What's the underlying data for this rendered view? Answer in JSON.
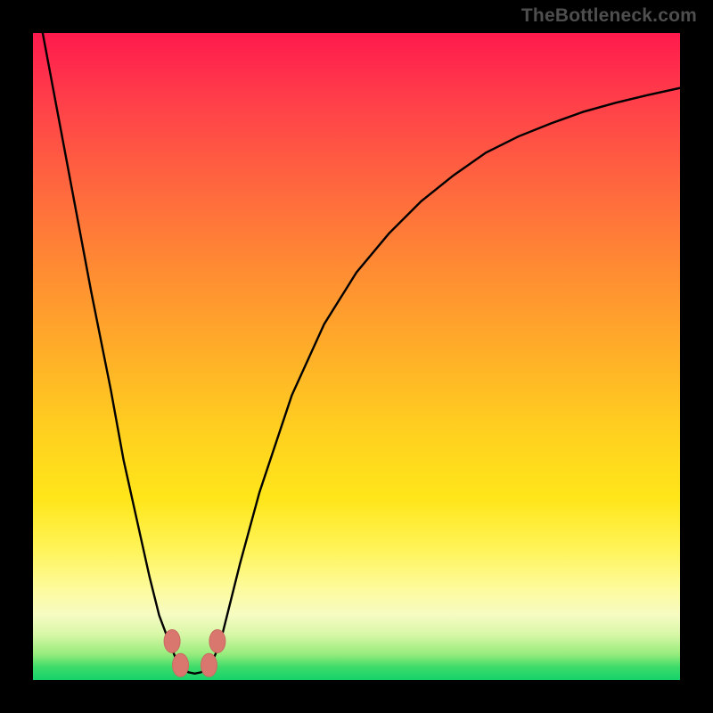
{
  "watermark": "TheBottleneck.com",
  "colors": {
    "curve": "#000000",
    "marker_fill": "#d9776e",
    "marker_stroke": "#c96a62"
  },
  "chart_data": {
    "type": "line",
    "title": "",
    "xlabel": "",
    "ylabel": "",
    "xlim": [
      0,
      100
    ],
    "ylim": [
      0,
      100
    ],
    "note": "axes unlabeled; values are reconstructed relative positions",
    "x": [
      0,
      3,
      6,
      9,
      12,
      14,
      16,
      18,
      19.5,
      21,
      22,
      23,
      24,
      25,
      26,
      27,
      28,
      29,
      30,
      32,
      35,
      40,
      45,
      50,
      55,
      60,
      65,
      70,
      75,
      80,
      85,
      90,
      95,
      100
    ],
    "y": [
      108,
      92,
      76,
      60,
      45,
      34,
      25,
      16,
      10,
      6,
      3.5,
      2,
      1.2,
      1,
      1.2,
      2,
      3.5,
      6,
      10,
      18,
      29,
      44,
      55,
      63,
      69,
      74,
      78,
      81.5,
      84,
      86,
      87.8,
      89.2,
      90.4,
      91.5
    ],
    "markers": [
      {
        "x": 21.5,
        "y": 6.0
      },
      {
        "x": 22.8,
        "y": 2.3
      },
      {
        "x": 27.2,
        "y": 2.3
      },
      {
        "x": 28.5,
        "y": 6.0
      }
    ]
  }
}
